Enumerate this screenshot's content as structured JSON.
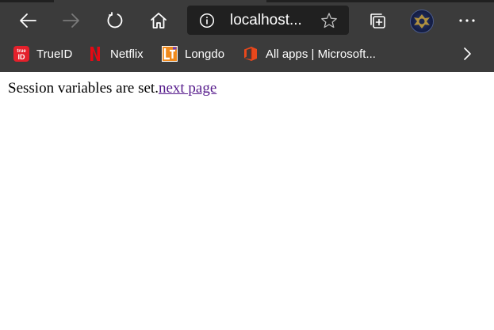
{
  "browser": {
    "address_bar": {
      "url": "localhost..."
    },
    "bookmarks": [
      {
        "label": "TrueID",
        "icon": "trueid-icon"
      },
      {
        "label": "Netflix",
        "icon": "netflix-icon"
      },
      {
        "label": "Longdo",
        "icon": "longdo-icon"
      },
      {
        "label": "All apps | Microsoft...",
        "icon": "microsoft-office-icon"
      }
    ],
    "colors": {
      "toolbar": "#3b3b3b",
      "address_bg": "#202020",
      "link_visited": "#551a8b"
    }
  },
  "page": {
    "message": "Session variables are set.",
    "link_text": "next page"
  }
}
